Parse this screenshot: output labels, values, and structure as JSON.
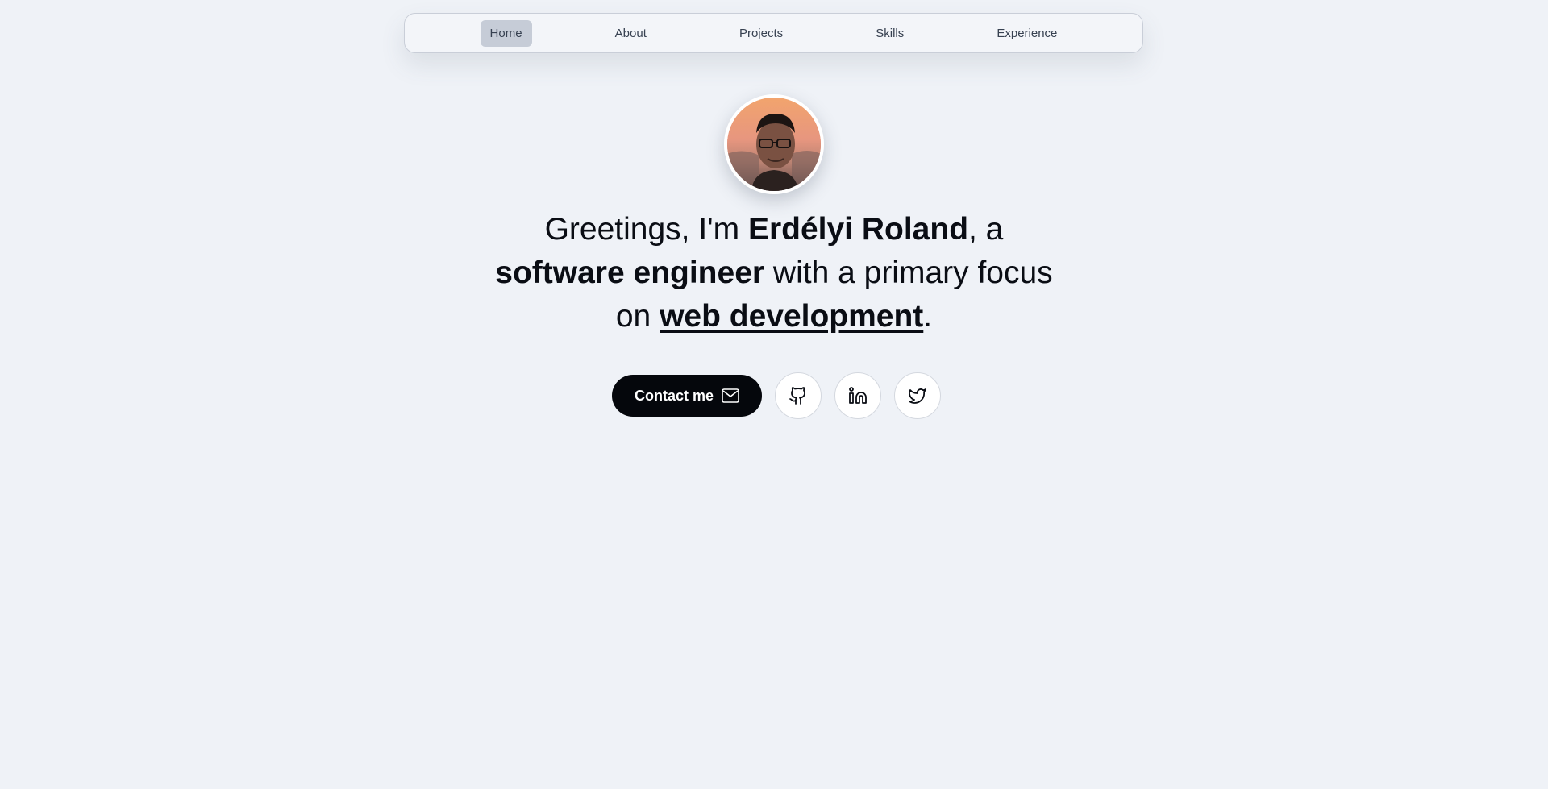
{
  "nav": {
    "items": [
      {
        "label": "Home",
        "active": true
      },
      {
        "label": "About",
        "active": false
      },
      {
        "label": "Projects",
        "active": false
      },
      {
        "label": "Skills",
        "active": false
      },
      {
        "label": "Experience",
        "active": false
      }
    ]
  },
  "profile": {
    "avatar_icon": "profile-photo"
  },
  "hero": {
    "greeting": "Greetings, I'm ",
    "name": "Erdélyi Roland",
    "mid1": ", a ",
    "role": "software engineer",
    "mid2": " with a primary focus on ",
    "focus": "web development",
    "end": "."
  },
  "actions": {
    "contact_label": "Contact me",
    "contact_icon": "mail-icon",
    "socials": [
      "github-icon",
      "linkedin-icon",
      "twitter-icon"
    ]
  },
  "colors": {
    "background": "#eff2f7",
    "nav_active": "#c6ccd7",
    "primary_button": "#05070c",
    "text": "#0a0d14"
  }
}
